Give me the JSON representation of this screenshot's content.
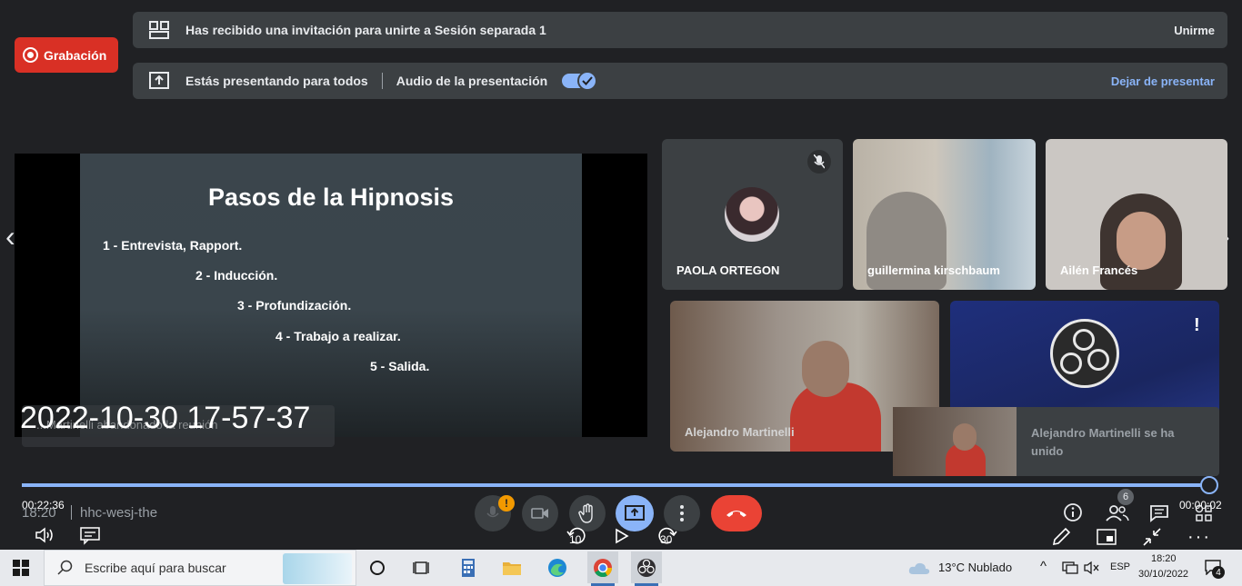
{
  "recording": {
    "label": "Grabación"
  },
  "invite_banner": {
    "text": "Has recibido una invitación para unirte a Sesión separada 1",
    "action": "Unirme"
  },
  "presenting_banner": {
    "text": "Estás presentando para todos",
    "audio_label": "Audio de la presentación",
    "audio_on": true,
    "action": "Dejar de presentar"
  },
  "slide": {
    "title": "Pasos de la Hipnosis",
    "steps": [
      "1 - Entrevista, Rapport.",
      "2 - Inducción.",
      "3 - Profundización.",
      "4 - Trabajo a realizar.",
      "5 - Salida."
    ]
  },
  "participants": [
    {
      "name": "PAOLA ORTEGON",
      "muted": true
    },
    {
      "name": "guillermina kirschbaum"
    },
    {
      "name": "Ailén Francés"
    },
    {
      "name": "Alejandro Martinelli"
    }
  ],
  "join_toast": {
    "text": "Alejandro Martinelli se ha unido"
  },
  "overlay": {
    "timestamp": "2022-10-30 17-57-37",
    "hidden_notice": "...Martinelli abandonado la reunión"
  },
  "player": {
    "elapsed": "00:22:36",
    "remaining": "00:00:02",
    "progress": 0.998,
    "skip_back": "10",
    "skip_forward": "30"
  },
  "meeting": {
    "time": "18:20",
    "code": "hhc-wesj-the",
    "participant_count": "6",
    "mic_alert": "!"
  },
  "colors": {
    "accent": "#8ab4f8",
    "record_red": "#d93025",
    "hangup_red": "#ea4335",
    "surface": "#3c4043",
    "background": "#202124"
  },
  "taskbar": {
    "search_placeholder": "Escribe aquí para buscar",
    "weather": "13°C  Nublado",
    "language": "ESP",
    "clock_time": "18:20",
    "clock_date": "30/10/2022",
    "notifications": "4"
  }
}
